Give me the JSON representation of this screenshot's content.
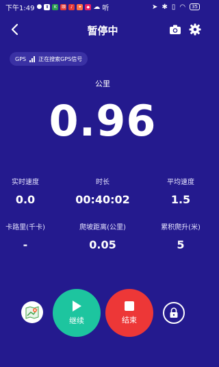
{
  "status_bar": {
    "time": "下午1:49",
    "battery": "35",
    "apps": [
      {
        "icon": "wechat-icon",
        "color": "#FFFFFF"
      },
      {
        "icon": "upload-icon",
        "color": "#FFFFFF"
      },
      {
        "icon": "keep-app-icon",
        "color": "#2A9D50"
      },
      {
        "icon": "app-red-icon",
        "color": "#E53935"
      },
      {
        "icon": "app-red-icon-2",
        "color": "#E53935"
      },
      {
        "icon": "app-orange-icon",
        "color": "#FF7043"
      },
      {
        "icon": "app-pink-icon",
        "color": "#E91E63"
      },
      {
        "icon": "cloud-icon",
        "color": "#FFFFFF"
      }
    ],
    "tail_text": "听"
  },
  "header": {
    "title": "暂停中"
  },
  "gps": {
    "prefix": "GPS",
    "text": "正在搜索GPS信号"
  },
  "distance": {
    "label": "公里",
    "value": "0.96"
  },
  "stats": {
    "speed_label": "实时速度",
    "speed_value": "0.0",
    "duration_label": "时长",
    "duration_value": "00:40:02",
    "avg_label": "平均速度",
    "avg_value": "1.5",
    "calorie_label": "卡路里(千卡)",
    "calorie_value": "-",
    "climb_dist_label": "爬坡距离(公里)",
    "climb_dist_value": "0.05",
    "elev_label": "累积爬升(米)",
    "elev_value": "5"
  },
  "controls": {
    "continue_label": "继续",
    "end_label": "结束"
  },
  "colors": {
    "background": "#241A8E",
    "continue": "#1DC59F",
    "end": "#ED3737"
  }
}
